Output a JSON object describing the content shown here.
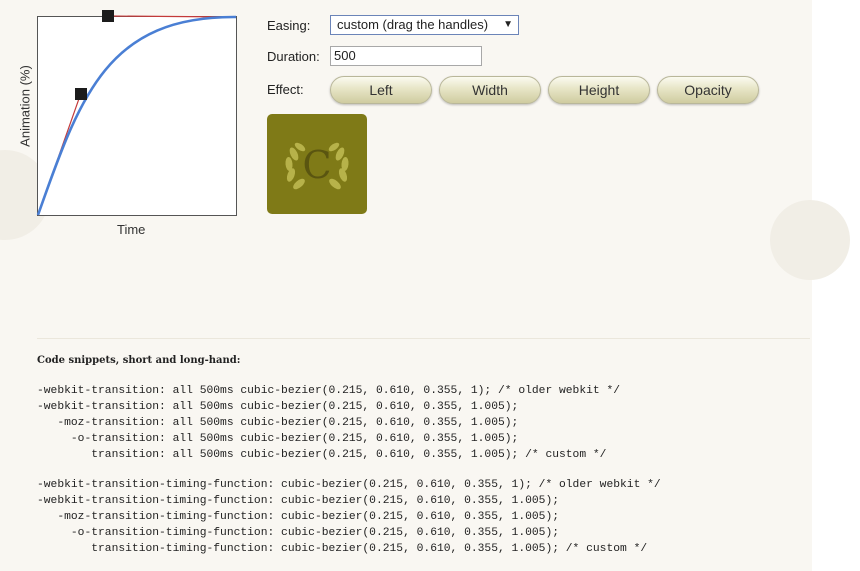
{
  "colors": {
    "curve": "#4a7fd4",
    "handle_line": "#c43a3a",
    "handle": "#1c1c1c",
    "demo_box": "#7f7a17",
    "laurel": "#b7b24a"
  },
  "graph": {
    "y_axis_label": "Animation (%)",
    "x_axis_label": "Time",
    "bezier": [
      0.215,
      0.61,
      0.355,
      1.005
    ]
  },
  "controls": {
    "easing_label": "Easing:",
    "easing_value": "custom (drag the handles)",
    "duration_label": "Duration:",
    "duration_value": "500",
    "effect_label": "Effect:",
    "buttons": [
      "Left",
      "Width",
      "Height",
      "Opacity"
    ]
  },
  "demo": {
    "letter": "C",
    "icon": "laurel-wreath-icon"
  },
  "snippets": {
    "title": "Code snippets, short and long-hand:",
    "transition_block": [
      "-webkit-transition: all 500ms cubic-bezier(0.215, 0.610, 0.355, 1); /* older webkit */",
      "-webkit-transition: all 500ms cubic-bezier(0.215, 0.610, 0.355, 1.005);",
      "   -moz-transition: all 500ms cubic-bezier(0.215, 0.610, 0.355, 1.005);",
      "     -o-transition: all 500ms cubic-bezier(0.215, 0.610, 0.355, 1.005);",
      "        transition: all 500ms cubic-bezier(0.215, 0.610, 0.355, 1.005); /* custom */"
    ],
    "timing_block": [
      "-webkit-transition-timing-function: cubic-bezier(0.215, 0.610, 0.355, 1); /* older webkit */",
      "-webkit-transition-timing-function: cubic-bezier(0.215, 0.610, 0.355, 1.005);",
      "   -moz-transition-timing-function: cubic-bezier(0.215, 0.610, 0.355, 1.005);",
      "     -o-transition-timing-function: cubic-bezier(0.215, 0.610, 0.355, 1.005);",
      "        transition-timing-function: cubic-bezier(0.215, 0.610, 0.355, 1.005); /* custom */"
    ]
  }
}
